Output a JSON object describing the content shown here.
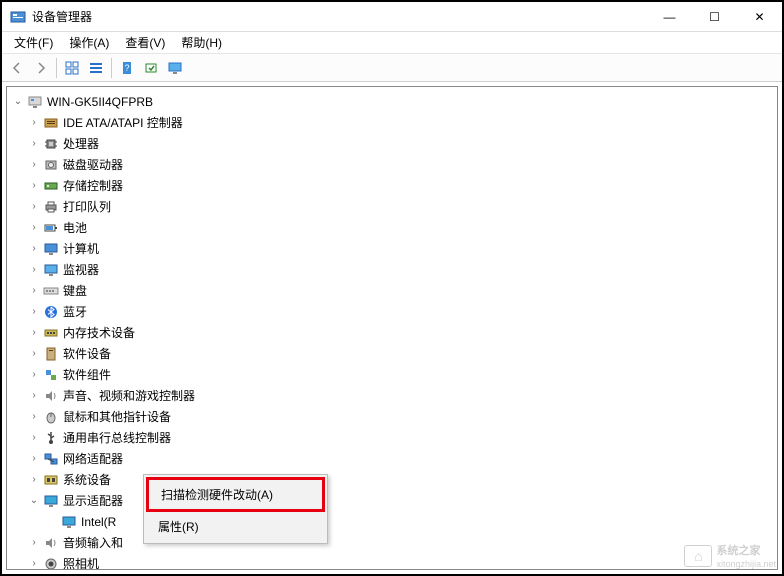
{
  "title": "设备管理器",
  "titlebar_buttons": {
    "min": "—",
    "max": "☐",
    "close": "✕"
  },
  "menu": {
    "file": "文件(F)",
    "action": "操作(A)",
    "view": "查看(V)",
    "help": "帮助(H)"
  },
  "tree": {
    "root": {
      "label": "WIN-GK5II4QFPRB"
    },
    "items": [
      {
        "label": "IDE ATA/ATAPI 控制器",
        "icon": "ide"
      },
      {
        "label": "处理器",
        "icon": "cpu"
      },
      {
        "label": "磁盘驱动器",
        "icon": "disk"
      },
      {
        "label": "存储控制器",
        "icon": "storage"
      },
      {
        "label": "打印队列",
        "icon": "printer"
      },
      {
        "label": "电池",
        "icon": "battery"
      },
      {
        "label": "计算机",
        "icon": "computer"
      },
      {
        "label": "监视器",
        "icon": "monitor"
      },
      {
        "label": "键盘",
        "icon": "keyboard"
      },
      {
        "label": "蓝牙",
        "icon": "bluetooth"
      },
      {
        "label": "内存技术设备",
        "icon": "memory"
      },
      {
        "label": "软件设备",
        "icon": "software"
      },
      {
        "label": "软件组件",
        "icon": "component"
      },
      {
        "label": "声音、视频和游戏控制器",
        "icon": "sound"
      },
      {
        "label": "鼠标和其他指针设备",
        "icon": "mouse"
      },
      {
        "label": "通用串行总线控制器",
        "icon": "usb"
      },
      {
        "label": "网络适配器",
        "icon": "network"
      },
      {
        "label": "系统设备",
        "icon": "system"
      },
      {
        "label": "显示适配器",
        "icon": "display",
        "expanded": true,
        "children": [
          {
            "label": "Intel(R",
            "icon": "display"
          }
        ]
      },
      {
        "label": "音频输入和",
        "icon": "audio"
      },
      {
        "label": "照相机",
        "icon": "camera"
      }
    ]
  },
  "context_menu": {
    "scan": "扫描检测硬件改动(A)",
    "properties": "属性(R)"
  },
  "watermark": {
    "text": "系统之家",
    "sub": "xitongzhijia.net"
  }
}
